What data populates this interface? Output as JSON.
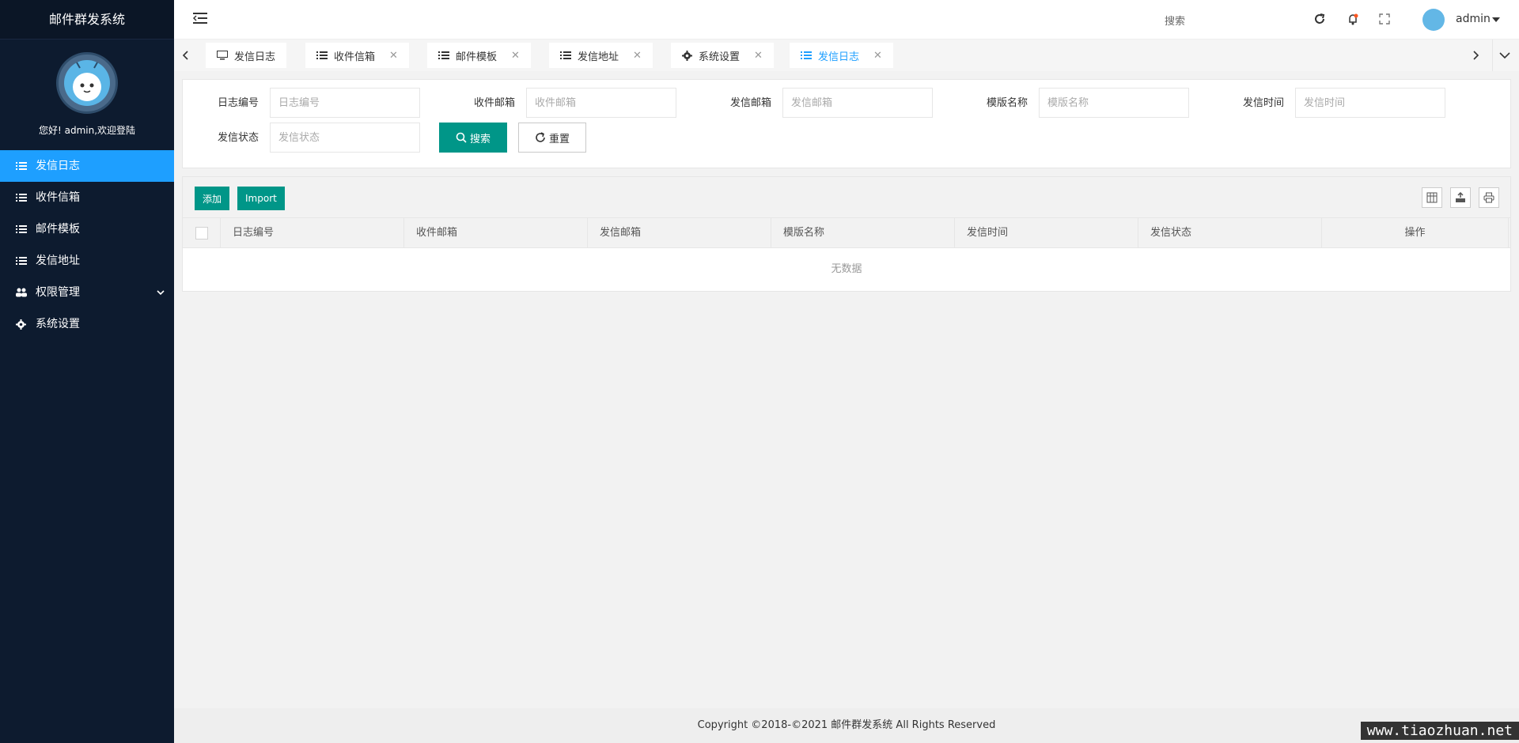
{
  "app": {
    "title": "邮件群发系统"
  },
  "sidebar": {
    "welcome": "您好! admin,欢迎登陆",
    "items": [
      {
        "label": "发信日志",
        "icon": "list-icon",
        "active": true
      },
      {
        "label": "收件信箱",
        "icon": "list-icon"
      },
      {
        "label": "邮件模板",
        "icon": "list-icon"
      },
      {
        "label": "发信地址",
        "icon": "list-icon"
      },
      {
        "label": "权限管理",
        "icon": "users-icon",
        "has_children": true
      },
      {
        "label": "系统设置",
        "icon": "gear-icon"
      }
    ]
  },
  "header": {
    "search_label": "搜索",
    "user": "admin",
    "icons": [
      "refresh-icon",
      "notification-icon",
      "fullscreen-icon"
    ]
  },
  "tabs": [
    {
      "label": "发信日志",
      "icon": "monitor-icon",
      "closable": false
    },
    {
      "label": "收件信箱",
      "icon": "list-icon",
      "closable": true
    },
    {
      "label": "邮件模板",
      "icon": "list-icon",
      "closable": true
    },
    {
      "label": "发信地址",
      "icon": "list-icon",
      "closable": true
    },
    {
      "label": "系统设置",
      "icon": "gear-icon",
      "closable": true
    },
    {
      "label": "发信日志",
      "icon": "list-icon",
      "closable": true,
      "active": true
    }
  ],
  "form": {
    "fields": [
      {
        "label": "日志编号",
        "placeholder": "日志编号"
      },
      {
        "label": "收件邮箱",
        "placeholder": "收件邮箱"
      },
      {
        "label": "发信邮箱",
        "placeholder": "发信邮箱"
      },
      {
        "label": "模版名称",
        "placeholder": "模版名称"
      },
      {
        "label": "发信时间",
        "placeholder": "发信时间"
      },
      {
        "label": "发信状态",
        "placeholder": "发信状态"
      }
    ],
    "search_label": "搜索",
    "reset_label": "重置"
  },
  "table": {
    "add_label": "添加",
    "import_label": "Import",
    "tool_icons": [
      "columns-icon",
      "export-icon",
      "print-icon"
    ],
    "columns": [
      "日志编号",
      "收件邮箱",
      "发信邮箱",
      "模版名称",
      "发信时间",
      "发信状态",
      "操作"
    ],
    "empty_text": "无数据"
  },
  "footer": {
    "copyright": "Copyright ©2018-©2021 邮件群发系统 All Rights Reserved"
  },
  "watermark": "www.tiaozhuan.net",
  "colors": {
    "sidebar": "#0d1b2f",
    "active": "#1e9fff",
    "primary": "#009688"
  }
}
